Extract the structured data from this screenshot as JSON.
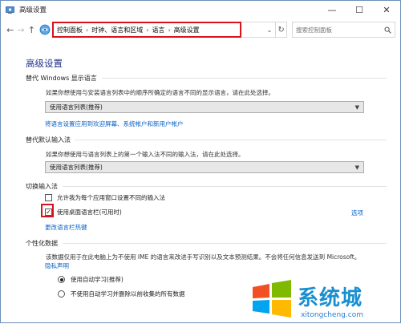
{
  "window": {
    "title": "高级设置",
    "controls": {
      "minimize": "—",
      "maximize": "☐",
      "close": "✕"
    }
  },
  "nav": {
    "back": "←",
    "forward": "→",
    "up": "↑",
    "breadcrumb": [
      "控制面板",
      "时钟、语言和区域",
      "语言",
      "高级设置"
    ],
    "separator": "›",
    "dropdown": "⌄",
    "refresh": "↻",
    "search_placeholder": "搜索控制面板"
  },
  "page_title": "高级设置",
  "sections": {
    "display_language": {
      "heading": "替代 Windows 显示语言",
      "description": "如果你想使用与安装语言列表中的顺序所确定的语言不同的显示语言，请在此处选择。",
      "select_value": "使用语言列表(推荐)",
      "link": "将语言设置应用到欢迎屏幕、系统帐户和新用户帐户"
    },
    "input_method": {
      "heading": "替代默认输入法",
      "description": "如果你想使用与语言列表上的第一个输入法不同的输入法，请在此处选择。",
      "select_value": "使用语言列表(推荐)"
    },
    "switch_input": {
      "heading": "切换输入法",
      "checkbox1_label": "允许我为每个应用窗口设置不同的输入法",
      "checkbox1_checked": false,
      "checkbox2_label": "使用桌面语言栏(可用时)",
      "checkbox2_checked": true,
      "options_link": "选项",
      "hotkey_link": "更改语言栏热键"
    },
    "personalization": {
      "heading": "个性化数据",
      "description": "该数据仅用于在此电脑上为不使用 IME 的语言来改进手写识别以及文本预测结果。不会将任何信息发送到 Microsoft。",
      "privacy_link": "隐私声明",
      "radio1_label": "使用自动学习(推荐)",
      "radio1_selected": true,
      "radio2_label": "不使用自动学习并删除以前收集的所有数据",
      "radio2_selected": false
    }
  },
  "watermark": {
    "text": "系统城",
    "url": "xitongcheng.com"
  },
  "colors": {
    "accent_title": "#1e3287",
    "link": "#0b62c4",
    "highlight_box": "#d9121b"
  }
}
